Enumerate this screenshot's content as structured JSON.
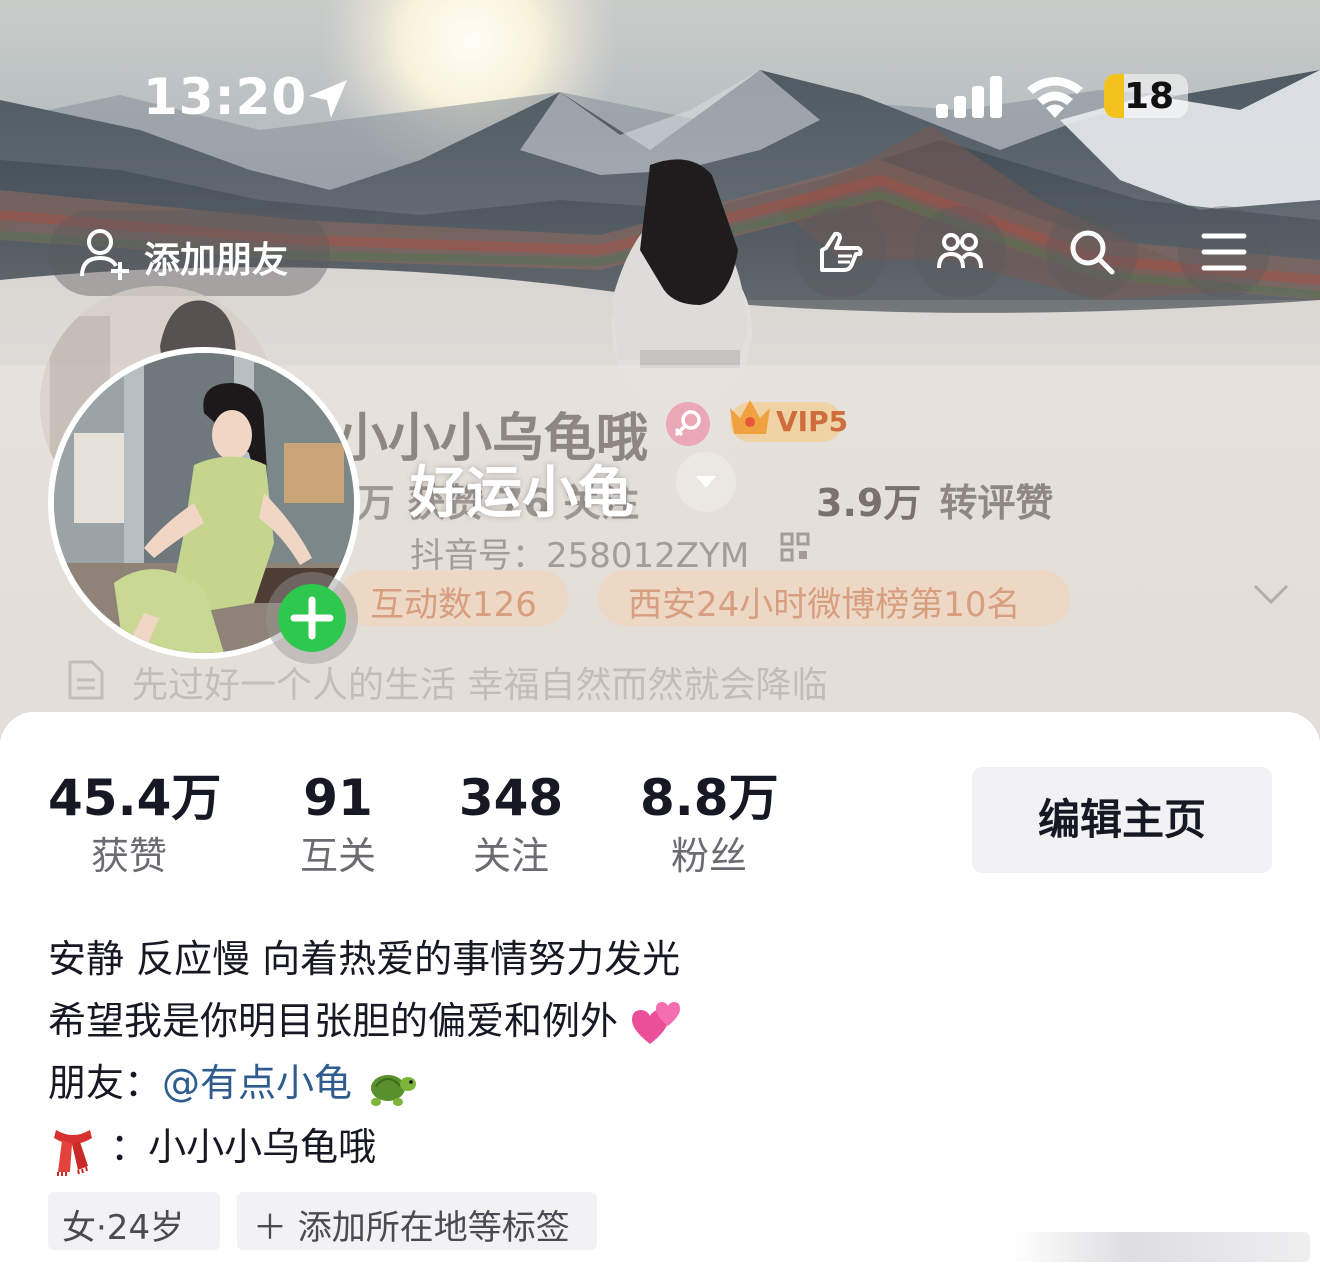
{
  "status_bar": {
    "time": "13:20",
    "battery": "18"
  },
  "top_bar": {
    "add_friend_label": "添加朋友"
  },
  "profile_overlay": {
    "name": "小小小乌龟哦",
    "vip": "VIP5",
    "nickname": "好运小龟",
    "stats_partial": "6万 获赞   76 关注",
    "stat3_value": "3.9万",
    "stat3_label": "转评赞",
    "douyin_id": "抖音号：258012ZYM",
    "tags": [
      "互动数126",
      "西安24小时微博榜第10名"
    ],
    "signature": "先过好一个人的生活 幸福自然而然就会降临"
  },
  "stats": [
    {
      "value": "45.4万",
      "label": "获赞"
    },
    {
      "value": "91",
      "label": "互关"
    },
    {
      "value": "348",
      "label": "关注"
    },
    {
      "value": "8.8万",
      "label": "粉丝"
    }
  ],
  "edit_button": "编辑主页",
  "bio": {
    "line1": "安静 反应慢 向着热爱的事情努力发光",
    "line2": "希望我是你明目张胆的偏爱和例外",
    "line3_prefix": "朋友：",
    "line3_mention": "@有点小龟",
    "line4": "：小小小乌龟哦"
  },
  "chips": [
    "女·24岁",
    "＋ 添加所在地等标签"
  ],
  "icons": [
    "location-arrow-icon",
    "signal-icon",
    "wifi-icon",
    "battery-icon",
    "add-user-icon",
    "hand-point-icon",
    "friends-icon",
    "search-icon",
    "menu-icon",
    "plus-icon",
    "heart-emoji",
    "turtle-emoji",
    "scarf-emoji"
  ],
  "colors": {
    "accent_green": "#2dc84d",
    "mention_blue": "#2f5b8f",
    "text_dark": "#161823"
  }
}
